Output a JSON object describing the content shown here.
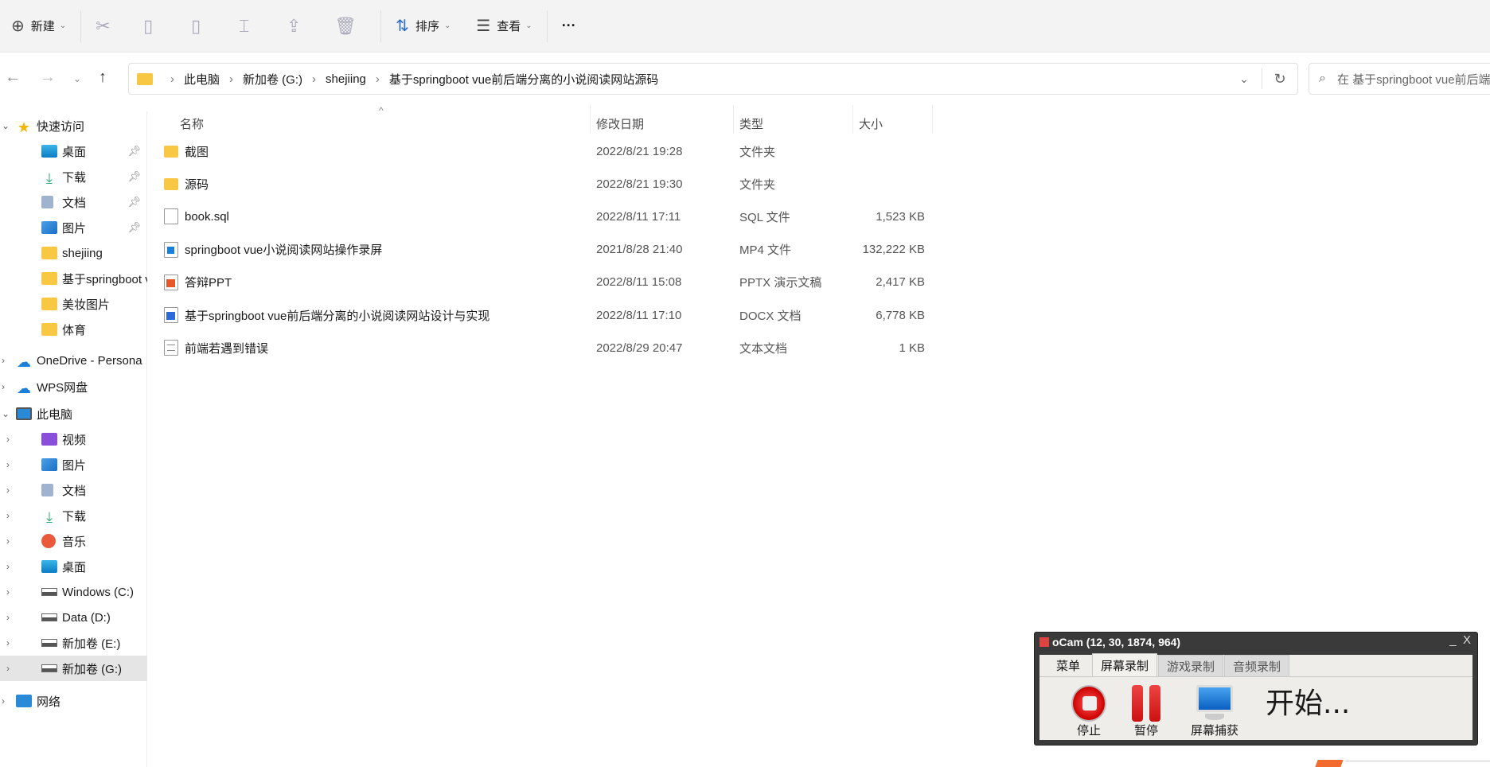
{
  "toolbar": {
    "new_label": "新建",
    "sort_label": "排序",
    "view_label": "查看",
    "more_label": "···"
  },
  "address": {
    "segments": [
      "此电脑",
      "新加卷 (G:)",
      "shejiing",
      "基于springboot vue前后端分离的小说阅读网站源码"
    ],
    "search_placeholder": "在 基于springboot vue前后端分离的小说阅读网站源码 中搜索"
  },
  "sidebar": {
    "items": [
      {
        "label": "快速访问",
        "icon": "star-icon",
        "level": 0
      },
      {
        "label": "桌面",
        "icon": "desktop-icon",
        "level": 1,
        "pinned": true
      },
      {
        "label": "下载",
        "icon": "download-icon",
        "level": 1,
        "pinned": true
      },
      {
        "label": "文档",
        "icon": "document-icon",
        "level": 1,
        "pinned": true
      },
      {
        "label": "图片",
        "icon": "pictures-icon",
        "level": 1,
        "pinned": true
      },
      {
        "label": "shejiing",
        "icon": "folder-icon",
        "level": 1
      },
      {
        "label": "基于springboot vue",
        "icon": "folder-icon",
        "level": 1
      },
      {
        "label": "美妆图片",
        "icon": "folder-icon",
        "level": 1
      },
      {
        "label": "体育",
        "icon": "folder-icon",
        "level": 1
      },
      {
        "label": "OneDrive - Persona",
        "icon": "cloud-icon",
        "level": 0
      },
      {
        "label": "WPS网盘",
        "icon": "cloud-icon",
        "level": 0
      },
      {
        "label": "此电脑",
        "icon": "computer-icon",
        "level": 0
      },
      {
        "label": "视频",
        "icon": "video-icon",
        "level": 1
      },
      {
        "label": "图片",
        "icon": "pictures-icon",
        "level": 1
      },
      {
        "label": "文档",
        "icon": "document-icon",
        "level": 1
      },
      {
        "label": "下载",
        "icon": "download-icon",
        "level": 1
      },
      {
        "label": "音乐",
        "icon": "music-icon",
        "level": 1
      },
      {
        "label": "桌面",
        "icon": "desktop-icon",
        "level": 1
      },
      {
        "label": "Windows (C:)",
        "icon": "drive-icon",
        "level": 1
      },
      {
        "label": "Data (D:)",
        "icon": "drive-icon",
        "level": 1
      },
      {
        "label": "新加卷 (E:)",
        "icon": "drive-icon",
        "level": 1
      },
      {
        "label": "新加卷 (G:)",
        "icon": "drive-icon",
        "level": 1,
        "selected": true
      },
      {
        "label": "网络",
        "icon": "network-icon",
        "level": 0
      }
    ]
  },
  "columns": {
    "name": "名称",
    "date": "修改日期",
    "type": "类型",
    "size": "大小"
  },
  "files": [
    {
      "name": "截图",
      "date": "2022/8/21 19:28",
      "type": "文件夹",
      "size": "",
      "icon": "folder"
    },
    {
      "name": "源码",
      "date": "2022/8/21 19:30",
      "type": "文件夹",
      "size": "",
      "icon": "folder"
    },
    {
      "name": "book.sql",
      "date": "2022/8/11 17:11",
      "type": "SQL 文件",
      "size": "1,523 KB",
      "icon": "file"
    },
    {
      "name": "springboot vue小说阅读网站操作录屏",
      "date": "2021/8/28 21:40",
      "type": "MP4 文件",
      "size": "132,222 KB",
      "icon": "video"
    },
    {
      "name": "答辩PPT",
      "date": "2022/8/11 15:08",
      "type": "PPTX 演示文稿",
      "size": "2,417 KB",
      "icon": "ppt"
    },
    {
      "name": "基于springboot vue前后端分离的小说阅读网站设计与实现",
      "date": "2022/8/11 17:10",
      "type": "DOCX 文档",
      "size": "6,778 KB",
      "icon": "word"
    },
    {
      "name": "前端若遇到错误",
      "date": "2022/8/29 20:47",
      "type": "文本文档",
      "size": "1 KB",
      "icon": "text"
    }
  ],
  "ocam": {
    "title": "oCam (12, 30, 1874, 964)",
    "tabs": [
      "菜单",
      "屏幕录制",
      "游戏录制",
      "音频录制"
    ],
    "stop": "停止",
    "pause": "暂停",
    "capture": "屏幕捕获",
    "status": "开始..."
  }
}
